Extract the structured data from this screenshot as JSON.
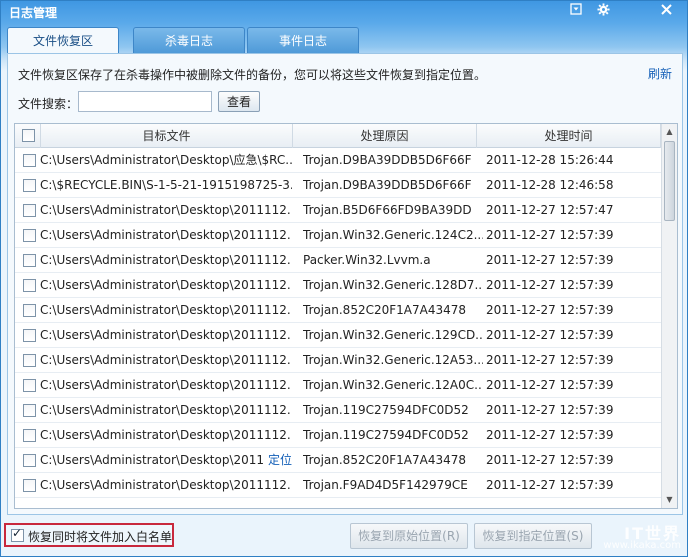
{
  "window": {
    "title": "日志管理"
  },
  "titlebar_icons": [
    "menu-icon",
    "gear-icon",
    "close-icon"
  ],
  "tabs": [
    {
      "label": "文件恢复区",
      "active": true
    },
    {
      "label": "杀毒日志",
      "active": false
    },
    {
      "label": "事件日志",
      "active": false
    }
  ],
  "description": "文件恢复区保存了在杀毒操作中被删除文件的备份，您可以将这些文件恢复到指定位置。",
  "refresh_label": "刷新",
  "search": {
    "label": "文件搜索：",
    "value": "",
    "button": "查看"
  },
  "table": {
    "columns": [
      "目标文件",
      "处理原因",
      "处理时间"
    ],
    "rows": [
      {
        "file": "C:\\Users\\Administrator\\Desktop\\应急\\$RC...",
        "reason": "Trojan.D9BA39DDB5D6F66F",
        "time": "2011-12-28 15:26:44",
        "locate": ""
      },
      {
        "file": "C:\\$RECYCLE.BIN\\S-1-5-21-1915198725-3...",
        "reason": "Trojan.D9BA39DDB5D6F66F",
        "time": "2011-12-28 12:46:58",
        "locate": ""
      },
      {
        "file": "C:\\Users\\Administrator\\Desktop\\2011112...",
        "reason": "Trojan.B5D6F66FD9BA39DD",
        "time": "2011-12-27 12:57:47",
        "locate": ""
      },
      {
        "file": "C:\\Users\\Administrator\\Desktop\\2011112...",
        "reason": "Trojan.Win32.Generic.124C2...",
        "time": "2011-12-27 12:57:39",
        "locate": ""
      },
      {
        "file": "C:\\Users\\Administrator\\Desktop\\2011112...",
        "reason": "Packer.Win32.Lvvm.a",
        "time": "2011-12-27 12:57:39",
        "locate": ""
      },
      {
        "file": "C:\\Users\\Administrator\\Desktop\\2011112...",
        "reason": "Trojan.Win32.Generic.128D7...",
        "time": "2011-12-27 12:57:39",
        "locate": ""
      },
      {
        "file": "C:\\Users\\Administrator\\Desktop\\2011112...",
        "reason": "Trojan.852C20F1A7A43478",
        "time": "2011-12-27 12:57:39",
        "locate": ""
      },
      {
        "file": "C:\\Users\\Administrator\\Desktop\\2011112...",
        "reason": "Trojan.Win32.Generic.129CD...",
        "time": "2011-12-27 12:57:39",
        "locate": ""
      },
      {
        "file": "C:\\Users\\Administrator\\Desktop\\2011112...",
        "reason": "Trojan.Win32.Generic.12A53...",
        "time": "2011-12-27 12:57:39",
        "locate": ""
      },
      {
        "file": "C:\\Users\\Administrator\\Desktop\\2011112...",
        "reason": "Trojan.Win32.Generic.12A0C...",
        "time": "2011-12-27 12:57:39",
        "locate": ""
      },
      {
        "file": "C:\\Users\\Administrator\\Desktop\\2011112...",
        "reason": "Trojan.119C27594DFC0D52",
        "time": "2011-12-27 12:57:39",
        "locate": ""
      },
      {
        "file": "C:\\Users\\Administrator\\Desktop\\2011112...",
        "reason": "Trojan.119C27594DFC0D52",
        "time": "2011-12-27 12:57:39",
        "locate": ""
      },
      {
        "file": "C:\\Users\\Administrator\\Desktop\\2011",
        "reason": "Trojan.852C20F1A7A43478",
        "time": "2011-12-27 12:57:39",
        "locate": "定位"
      },
      {
        "file": "C:\\Users\\Administrator\\Desktop\\2011112...",
        "reason": "Trojan.F9AD4D5F142979CE",
        "time": "2011-12-27 12:57:39",
        "locate": ""
      }
    ]
  },
  "footer": {
    "whitelist_label": "恢复同时将文件加入白名单",
    "whitelist_checked": true,
    "restore_original_button": "恢复到原始位置(R)",
    "restore_specified_button": "恢复到指定位置(S)",
    "watermark_top": "IT世界",
    "watermark_bottom": "www.ikaka.com"
  }
}
